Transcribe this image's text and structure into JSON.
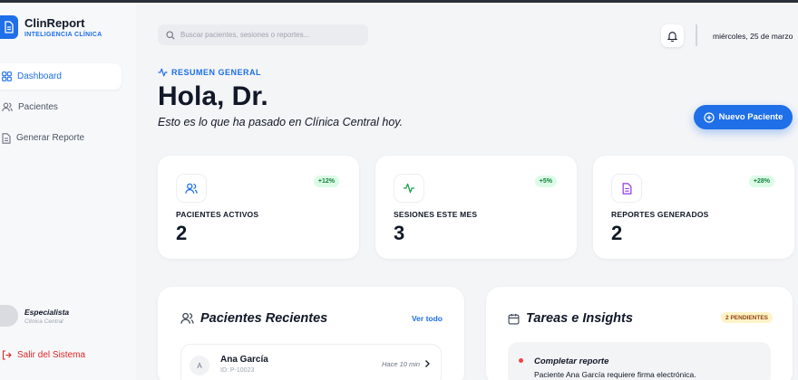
{
  "brand": {
    "title": "ClinReport",
    "subtitle": "INTELIGENCIA CLÍNICA"
  },
  "sidebar": {
    "items": [
      {
        "label": "Dashboard",
        "icon": "grid-icon",
        "active": true
      },
      {
        "label": "Pacientes",
        "icon": "users-icon",
        "active": false
      },
      {
        "label": "Generar Reporte",
        "icon": "document-icon",
        "active": false
      }
    ],
    "user": {
      "role": "Especialista",
      "clinic": "Clínica Central"
    },
    "logout_label": "Salir del Sistema"
  },
  "header": {
    "search_placeholder": "Buscar pacientes, sesiones o reportes...",
    "date": "miércoles, 25 de marzo"
  },
  "hero": {
    "eyebrow": "RESUMEN GENERAL",
    "greeting": "Hola, Dr.",
    "subtitle": "Esto es lo que ha pasado en Clínica Central hoy.",
    "new_patient_label": "Nuevo Paciente"
  },
  "stats": [
    {
      "label": "PACIENTES ACTIVOS",
      "value": "2",
      "change": "+12%",
      "icon": "users-icon",
      "color": "#1e6fe8"
    },
    {
      "label": "SESIONES ESTE MES",
      "value": "3",
      "change": "+5%",
      "icon": "activity-icon",
      "color": "#16a34a"
    },
    {
      "label": "REPORTES GENERADOS",
      "value": "2",
      "change": "+28%",
      "icon": "document-icon",
      "color": "#9333ea"
    }
  ],
  "recent_patients": {
    "title": "Pacientes Recientes",
    "view_all": "Ver todo",
    "rows": [
      {
        "initial": "A",
        "name": "Ana García",
        "id": "ID: P-10023",
        "time": "Hace 10 min"
      }
    ]
  },
  "tasks": {
    "title": "Tareas e Insights",
    "badge": "2 PENDIENTES",
    "items": [
      {
        "title": "Completar reporte",
        "description": "Paciente Ana García requiere firma electrónica."
      }
    ]
  },
  "colors": {
    "accent": "#1e6fe8",
    "danger": "#dc2626",
    "success_bg": "#dcfce7",
    "warning_bg": "#fef3c7"
  }
}
